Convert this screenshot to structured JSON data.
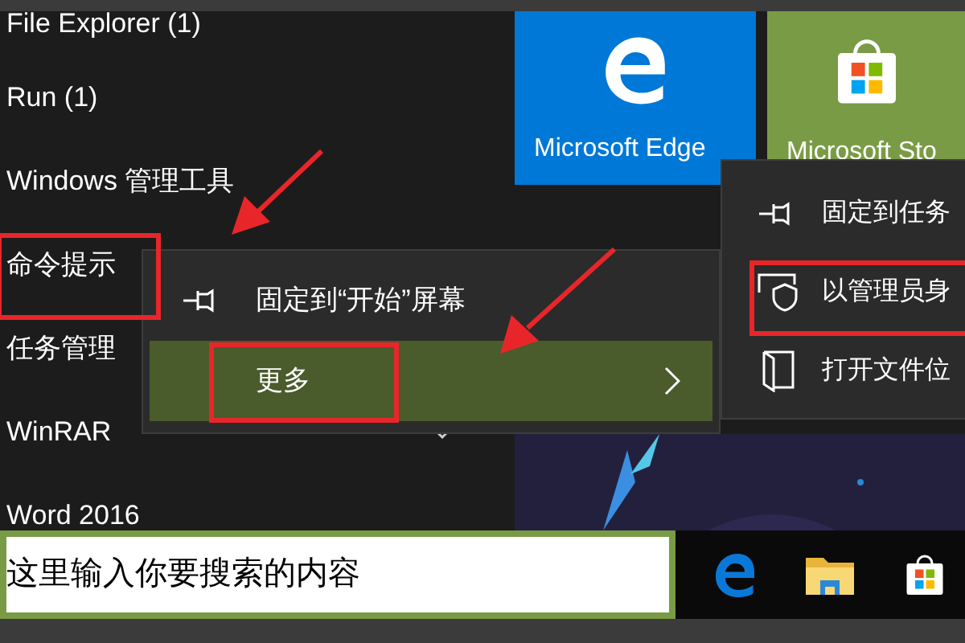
{
  "app_list": [
    {
      "label": "File Explorer (1)",
      "expandable": false
    },
    {
      "label": "Run (1)",
      "expandable": false
    },
    {
      "label": "Windows 管理工具",
      "expandable": false
    },
    {
      "label": "命令提示",
      "expandable": false
    },
    {
      "label": "任务管理",
      "expandable": false
    },
    {
      "label": "WinRAR",
      "expandable": true
    },
    {
      "label": "Word 2016",
      "expandable": false
    }
  ],
  "tiles": [
    {
      "kind": "edge",
      "label": "Microsoft Edge"
    },
    {
      "kind": "store",
      "label": "Microsoft Sto"
    }
  ],
  "context_menu": {
    "items": [
      {
        "kind": "pin",
        "label": "固定到“开始”屏幕",
        "selected": false,
        "submenu": false
      },
      {
        "kind": "plain",
        "label": "更多",
        "selected": true,
        "submenu": true
      }
    ]
  },
  "submenu": {
    "items": [
      {
        "kind": "pin",
        "label": "固定到任务"
      },
      {
        "kind": "shield",
        "label": "以管理员身"
      },
      {
        "kind": "file",
        "label": "打开文件位"
      }
    ]
  },
  "search": {
    "placeholder": "这里输入你要搜索的内容"
  },
  "taskbar": [
    {
      "kind": "edge"
    },
    {
      "kind": "explorer"
    },
    {
      "kind": "store"
    }
  ]
}
